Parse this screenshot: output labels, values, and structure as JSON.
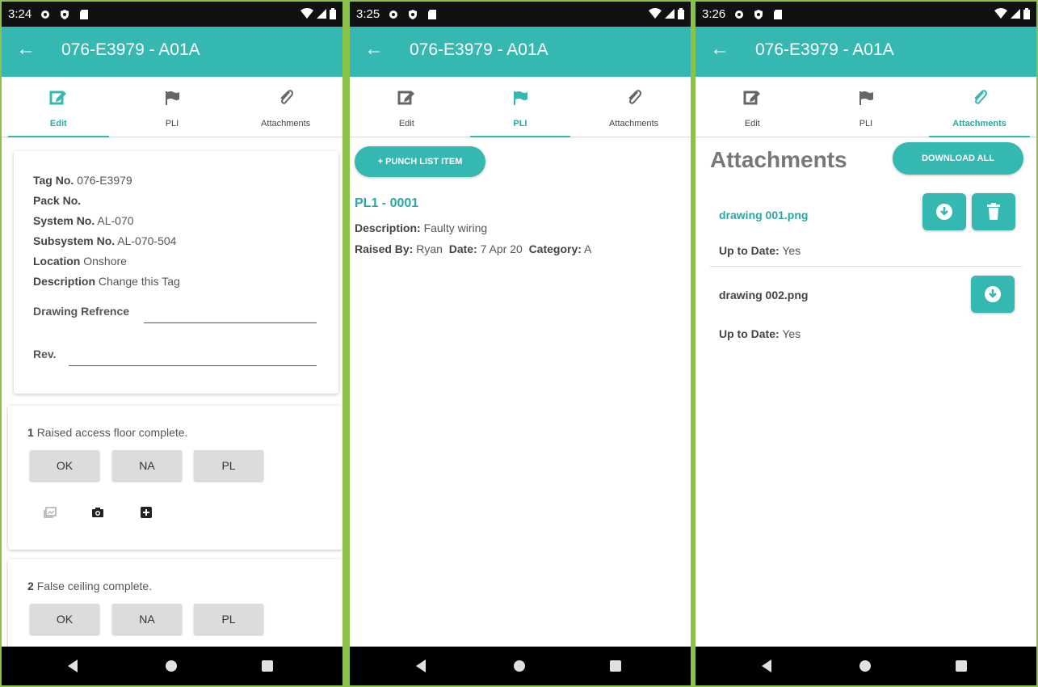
{
  "colors": {
    "accent": "#35b8b2",
    "frame": "#8bc34a",
    "statusbar": "#111111"
  },
  "panels": [
    {
      "status_time": "3:24",
      "title": "076-E3979 - A01A",
      "tabs": [
        "Edit",
        "PLI",
        "Attachments"
      ],
      "active_tab": "Edit",
      "info": {
        "tag_label": "Tag No.",
        "tag_value": "076-E3979",
        "pack_label": "Pack No.",
        "pack_value": "",
        "system_label": "System No.",
        "system_value": "AL-070",
        "subsystem_label": "Subsystem No.",
        "subsystem_value": "AL-070-504",
        "location_label": "Location",
        "location_value": "Onshore",
        "description_label": "Description",
        "description_value": "Change this Tag",
        "drawing_label": "Drawing Refrence",
        "drawing_value": "",
        "rev_label": "Rev.",
        "rev_value": ""
      },
      "checks": [
        {
          "num": "1",
          "text": "Raised access floor complete.",
          "buttons": [
            "OK",
            "NA",
            "PL"
          ]
        },
        {
          "num": "2",
          "text": "False ceiling complete.",
          "buttons": [
            "OK",
            "NA",
            "PL"
          ]
        }
      ],
      "icons": [
        "gallery-icon",
        "camera-icon",
        "add-box-icon"
      ]
    },
    {
      "status_time": "3:25",
      "title": "076-E3979 - A01A",
      "tabs": [
        "Edit",
        "PLI",
        "Attachments"
      ],
      "active_tab": "PLI",
      "add_button": "+ PUNCH LIST ITEM",
      "item": {
        "title": "PL1 - 0001",
        "description_label": "Description:",
        "description_value": "Faulty wiring",
        "raised_label": "Raised By:",
        "raised_value": "Ryan",
        "date_label": "Date:",
        "date_value": "7 Apr 20",
        "category_label": "Category:",
        "category_value": "A"
      }
    },
    {
      "status_time": "3:26",
      "title": "076-E3979 - A01A",
      "tabs": [
        "Edit",
        "PLI",
        "Attachments"
      ],
      "active_tab": "Attachments",
      "heading": "Attachments",
      "download_all": "DOWNLOAD ALL",
      "files": [
        {
          "name": "drawing 001.png",
          "uptodate_label": "Up to Date:",
          "uptodate_value": "Yes",
          "color": "#2aa8a2",
          "actions": [
            "download",
            "delete"
          ]
        },
        {
          "name": "drawing 002.png",
          "uptodate_label": "Up to Date:",
          "uptodate_value": "Yes",
          "color": "#444444",
          "actions": [
            "download"
          ]
        }
      ]
    }
  ]
}
